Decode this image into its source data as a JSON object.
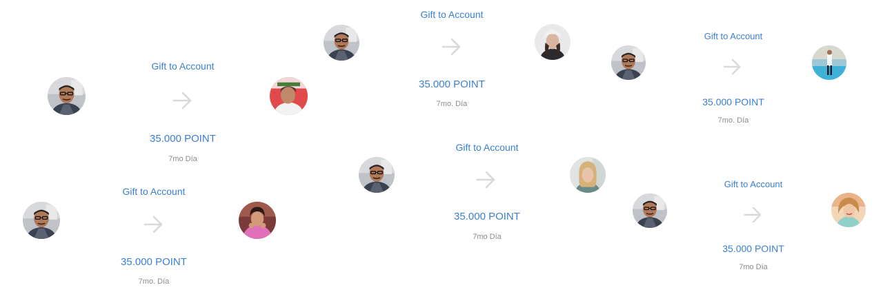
{
  "colors": {
    "accent": "#3a7fd4",
    "muted": "#8a8a8a",
    "arrow": "#d9d9d9"
  },
  "cards": [
    {
      "gift_label": "Gift to Account",
      "points": "35.000 POINT",
      "day": "7mo Día",
      "sender_icon": "man-glasses-avatar",
      "receiver_icon": "man-red-background-avatar"
    },
    {
      "gift_label": "Gift to Account",
      "points": "35.000 POINT",
      "day": "7mo. Día",
      "sender_icon": "man-glasses-avatar",
      "receiver_icon": "woman-cap-avatar"
    },
    {
      "gift_label": "Gift to Account",
      "points": "35.000 POINT",
      "day": "7mo. Día",
      "sender_icon": "man-glasses-avatar",
      "receiver_icon": "man-pool-avatar"
    },
    {
      "gift_label": "Gift to Account",
      "points": "35.000 POINT",
      "day": "7mo. Día",
      "sender_icon": "man-glasses-avatar",
      "receiver_icon": "girl-pink-avatar"
    },
    {
      "gift_label": "Gift to Account",
      "points": "35.000 POINT",
      "day": "7mo Día",
      "sender_icon": "man-glasses-avatar",
      "receiver_icon": "woman-blonde-avatar"
    },
    {
      "gift_label": "Gift to Account",
      "points": "35.000 POINT",
      "day": "7mo Día",
      "sender_icon": "man-glasses-avatar",
      "receiver_icon": "woman-smiling-avatar"
    }
  ]
}
